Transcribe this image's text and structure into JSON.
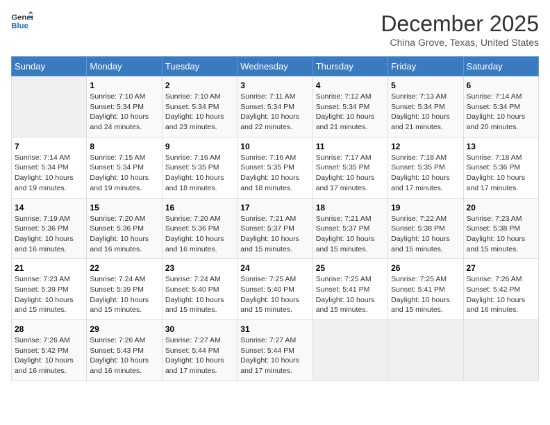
{
  "logo": {
    "line1": "General",
    "line2": "Blue"
  },
  "title": "December 2025",
  "location": "China Grove, Texas, United States",
  "days_of_week": [
    "Sunday",
    "Monday",
    "Tuesday",
    "Wednesday",
    "Thursday",
    "Friday",
    "Saturday"
  ],
  "weeks": [
    [
      {
        "day": "",
        "info": ""
      },
      {
        "day": "1",
        "info": "Sunrise: 7:10 AM\nSunset: 5:34 PM\nDaylight: 10 hours\nand 24 minutes."
      },
      {
        "day": "2",
        "info": "Sunrise: 7:10 AM\nSunset: 5:34 PM\nDaylight: 10 hours\nand 23 minutes."
      },
      {
        "day": "3",
        "info": "Sunrise: 7:11 AM\nSunset: 5:34 PM\nDaylight: 10 hours\nand 22 minutes."
      },
      {
        "day": "4",
        "info": "Sunrise: 7:12 AM\nSunset: 5:34 PM\nDaylight: 10 hours\nand 21 minutes."
      },
      {
        "day": "5",
        "info": "Sunrise: 7:13 AM\nSunset: 5:34 PM\nDaylight: 10 hours\nand 21 minutes."
      },
      {
        "day": "6",
        "info": "Sunrise: 7:14 AM\nSunset: 5:34 PM\nDaylight: 10 hours\nand 20 minutes."
      }
    ],
    [
      {
        "day": "7",
        "info": "Sunrise: 7:14 AM\nSunset: 5:34 PM\nDaylight: 10 hours\nand 19 minutes."
      },
      {
        "day": "8",
        "info": "Sunrise: 7:15 AM\nSunset: 5:34 PM\nDaylight: 10 hours\nand 19 minutes."
      },
      {
        "day": "9",
        "info": "Sunrise: 7:16 AM\nSunset: 5:35 PM\nDaylight: 10 hours\nand 18 minutes."
      },
      {
        "day": "10",
        "info": "Sunrise: 7:16 AM\nSunset: 5:35 PM\nDaylight: 10 hours\nand 18 minutes."
      },
      {
        "day": "11",
        "info": "Sunrise: 7:17 AM\nSunset: 5:35 PM\nDaylight: 10 hours\nand 17 minutes."
      },
      {
        "day": "12",
        "info": "Sunrise: 7:18 AM\nSunset: 5:35 PM\nDaylight: 10 hours\nand 17 minutes."
      },
      {
        "day": "13",
        "info": "Sunrise: 7:18 AM\nSunset: 5:36 PM\nDaylight: 10 hours\nand 17 minutes."
      }
    ],
    [
      {
        "day": "14",
        "info": "Sunrise: 7:19 AM\nSunset: 5:36 PM\nDaylight: 10 hours\nand 16 minutes."
      },
      {
        "day": "15",
        "info": "Sunrise: 7:20 AM\nSunset: 5:36 PM\nDaylight: 10 hours\nand 16 minutes."
      },
      {
        "day": "16",
        "info": "Sunrise: 7:20 AM\nSunset: 5:36 PM\nDaylight: 10 hours\nand 16 minutes."
      },
      {
        "day": "17",
        "info": "Sunrise: 7:21 AM\nSunset: 5:37 PM\nDaylight: 10 hours\nand 15 minutes."
      },
      {
        "day": "18",
        "info": "Sunrise: 7:21 AM\nSunset: 5:37 PM\nDaylight: 10 hours\nand 15 minutes."
      },
      {
        "day": "19",
        "info": "Sunrise: 7:22 AM\nSunset: 5:38 PM\nDaylight: 10 hours\nand 15 minutes."
      },
      {
        "day": "20",
        "info": "Sunrise: 7:23 AM\nSunset: 5:38 PM\nDaylight: 10 hours\nand 15 minutes."
      }
    ],
    [
      {
        "day": "21",
        "info": "Sunrise: 7:23 AM\nSunset: 5:39 PM\nDaylight: 10 hours\nand 15 minutes."
      },
      {
        "day": "22",
        "info": "Sunrise: 7:24 AM\nSunset: 5:39 PM\nDaylight: 10 hours\nand 15 minutes."
      },
      {
        "day": "23",
        "info": "Sunrise: 7:24 AM\nSunset: 5:40 PM\nDaylight: 10 hours\nand 15 minutes."
      },
      {
        "day": "24",
        "info": "Sunrise: 7:25 AM\nSunset: 5:40 PM\nDaylight: 10 hours\nand 15 minutes."
      },
      {
        "day": "25",
        "info": "Sunrise: 7:25 AM\nSunset: 5:41 PM\nDaylight: 10 hours\nand 15 minutes."
      },
      {
        "day": "26",
        "info": "Sunrise: 7:25 AM\nSunset: 5:41 PM\nDaylight: 10 hours\nand 15 minutes."
      },
      {
        "day": "27",
        "info": "Sunrise: 7:26 AM\nSunset: 5:42 PM\nDaylight: 10 hours\nand 16 minutes."
      }
    ],
    [
      {
        "day": "28",
        "info": "Sunrise: 7:26 AM\nSunset: 5:42 PM\nDaylight: 10 hours\nand 16 minutes."
      },
      {
        "day": "29",
        "info": "Sunrise: 7:26 AM\nSunset: 5:43 PM\nDaylight: 10 hours\nand 16 minutes."
      },
      {
        "day": "30",
        "info": "Sunrise: 7:27 AM\nSunset: 5:44 PM\nDaylight: 10 hours\nand 17 minutes."
      },
      {
        "day": "31",
        "info": "Sunrise: 7:27 AM\nSunset: 5:44 PM\nDaylight: 10 hours\nand 17 minutes."
      },
      {
        "day": "",
        "info": ""
      },
      {
        "day": "",
        "info": ""
      },
      {
        "day": "",
        "info": ""
      }
    ]
  ]
}
